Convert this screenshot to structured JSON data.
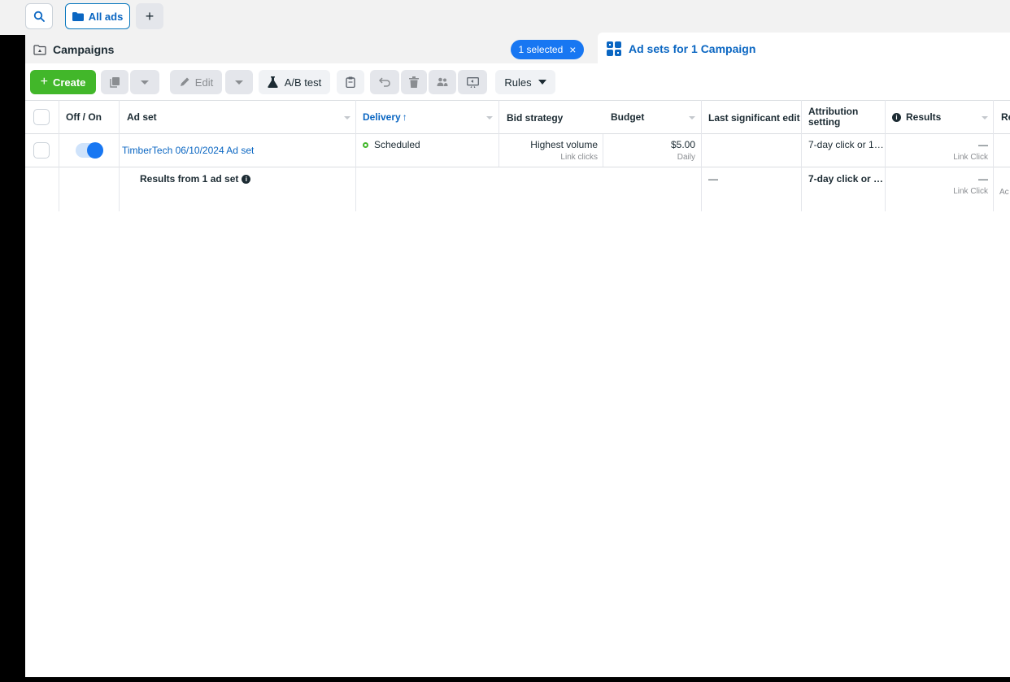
{
  "topbar": {
    "search_icon": "search-icon",
    "all_ads_label": "All ads",
    "add_label": "+"
  },
  "tabs": {
    "campaigns_label": "Campaigns",
    "selected_chip_label": "1 selected",
    "selected_chip_close": "×",
    "adsets_label": "Ad sets for 1 Campaign"
  },
  "toolbar": {
    "create_label": "Create",
    "edit_label": "Edit",
    "ab_test_label": "A/B test",
    "rules_label": "Rules"
  },
  "table": {
    "columns": {
      "off_on": "Off / On",
      "ad_set": "Ad set",
      "delivery": "Delivery",
      "delivery_sort": "↑",
      "bid_strategy": "Bid strategy",
      "budget": "Budget",
      "last_edit": "Last significant edit",
      "attribution_line1": "Attribution",
      "attribution_line2": "setting",
      "results": "Results",
      "reach_partial": "Re"
    },
    "row": {
      "name": "TimberTech 06/10/2024 Ad set",
      "toggle_on": true,
      "delivery": "Scheduled",
      "bid_strategy": "Highest volume",
      "bid_strategy_sub": "Link clicks",
      "budget": "$5.00",
      "budget_sub": "Daily",
      "last_edit": "",
      "attribution": "7-day click or 1…",
      "results": "—",
      "results_sub": "Link Click"
    },
    "summary": {
      "label": "Results from 1 ad set",
      "last_edit": "—",
      "attribution": "7-day click or …",
      "results": "—",
      "results_sub": "Link Click",
      "reach_sub_partial": "Ac"
    }
  },
  "colors": {
    "accent": "#1877f2",
    "link": "#0a66c2",
    "create_green": "#42b72a",
    "status_green": "#42b72a"
  }
}
